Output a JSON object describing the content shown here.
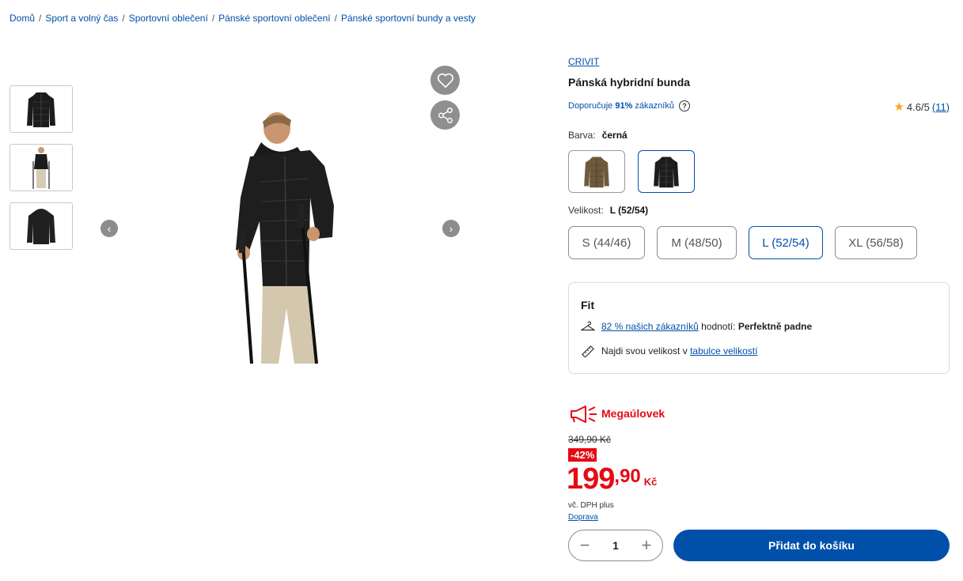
{
  "breadcrumb": {
    "items": [
      "Domů",
      "Sport a volný čas",
      "Sportovní oblečení",
      "Pánské sportovní oblečení",
      "Pánské sportovní bundy a vesty"
    ],
    "separator": "/"
  },
  "product": {
    "brand": "CRIVIT",
    "title": "Pánská hybridní bunda",
    "recommend_prefix": "Doporučuje",
    "recommend_percent": "91%",
    "recommend_suffix": "zákazníků",
    "rating": "4.6/5",
    "rating_count": "(11)"
  },
  "color": {
    "label": "Barva:",
    "selected": "černá",
    "options": [
      "olive-jacket",
      "black-jacket"
    ]
  },
  "size": {
    "label": "Velikost:",
    "selected": "L (52/54)",
    "options": [
      "S (44/46)",
      "M (48/50)",
      "L (52/54)",
      "XL (56/58)"
    ]
  },
  "fit": {
    "title": "Fit",
    "rating_link": "82 % našich zákazníků",
    "rating_mid": "hodnotí:",
    "rating_value": "Perfektně padne",
    "size_text": "Najdi svou velikost v",
    "size_link": "tabulce velikostí"
  },
  "pricing": {
    "badge": "Megaúlovek",
    "old_price": "349,90 Kč",
    "discount": "-42%",
    "price_main": "199",
    "price_frac": ",90",
    "currency": "Kč",
    "vat": "vč. DPH plus",
    "shipping": "Doprava"
  },
  "cart": {
    "quantity": "1",
    "minus": "−",
    "plus": "+",
    "add_label": "Přidat do košíku"
  },
  "colors": {
    "accent": "#0050aa",
    "sale": "#e60a14"
  }
}
